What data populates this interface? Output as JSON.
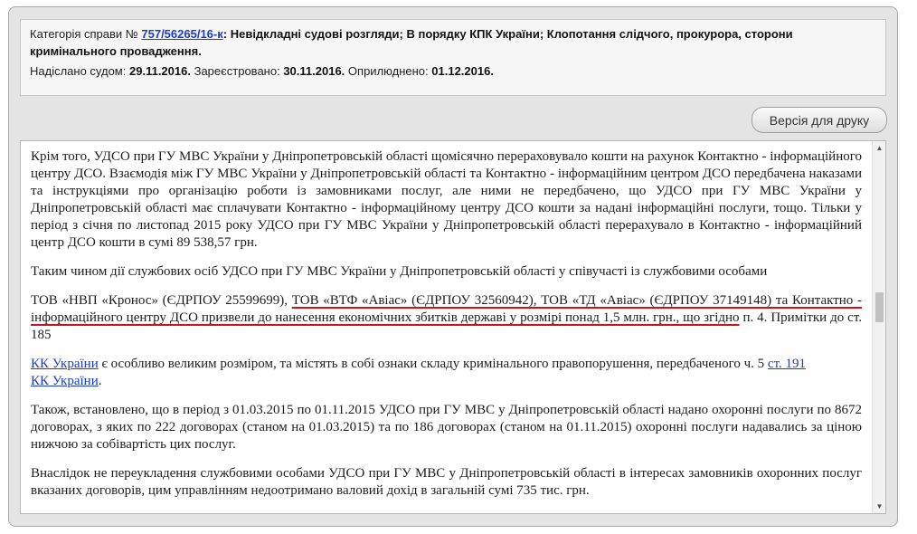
{
  "header": {
    "category_label": "Категорія справи №",
    "case_number": "757/56265/16-к",
    "category_text": "Невідкладні судові розгляди; В порядку КПК України; Клопотання слідчого, прокурора, сторони кримінального провадження.",
    "sent_label": "Надіслано судом:",
    "sent_date": "29.11.2016.",
    "registered_label": "Зареєстровано:",
    "registered_date": "30.11.2016.",
    "published_label": "Оприлюднено:",
    "published_date": "01.12.2016."
  },
  "toolbar": {
    "print_label": "Версія для друку"
  },
  "document": {
    "p1": "Крім того, УДСО при ГУ МВС України у Дніпропетровській області щомісячно перераховувало кошти на рахунок Контактно - інформаційного центру ДСО. Взаємодія між ГУ МВС України у Дніпропетровській області та Контактно - інформаційним центром ДСО передбачена наказами та інструкціями про організацію роботи із замовниками послуг, але ними не передбачено, що УДСО при ГУ МВС України у Дніпропетровській області має сплачувати Контактно - інформаційному центру ДСО кошти за надані інформаційні послуги, тощо. Тільки у період з січня по листопад 2015 року УДСО при ГУ МВС України у Дніпропетровській області перерахувало в Контактно - інформаційний центр ДСО кошти в сумі 89 538,57 грн.",
    "p2": "Таким чином дії службових осіб УДСО при ГУ МВС України у Дніпропетровській області у співучасті із службовими особами",
    "p3_start": "ТОВ «НВП «Кронос» (ЄДРПОУ 25599699), ",
    "p3_underlined": "ТОВ «ВТФ «Авіас» (ЄДРПОУ 32560942), ТОВ «ТД «Авіас» (ЄДРПОУ 37149148) та Контактно - інформаційного центру ДСО призвели до нанесення економічних збитків державі у розмірі понад 1,5 млн. грн., що згідно",
    "p3_end": " п. 4. Примітки до ст. 185",
    "p4_link1": "КК України",
    "p4_text": " є особливо великим розміром, та містять в собі ознаки складу кримінального правопорушення, передбаченого ч. 5 ",
    "p4_link2": "ст. 191",
    "p4_link3": "КК України",
    "p4_end": ".",
    "p5": "Також, встановлено, що в період з 01.03.2015 по 01.11.2015 УДСО при ГУ МВС у Дніпропетровській області надано охоронні послуги по 8672 договорах, з яких по 222 договорах (станом на 01.03.2015) та по 186 договорах (станом на 01.11.2015) охоронні послуги надавались за ціною нижчою за собівартість цих послуг.",
    "p6": "Внаслідок не переукладення службовими особами УДСО при ГУ МВС у Дніпропетровській області в інтересах замовників охоронних послуг вказаних договорів, цим управлінням недоотримано валовий дохід в загальній сумі 735 тис. грн."
  },
  "scrollbar": {
    "up_icon": "▲",
    "down_icon": "▼"
  },
  "colors": {
    "link": "#1a3dc8",
    "highlight_underline": "#d0111b"
  }
}
